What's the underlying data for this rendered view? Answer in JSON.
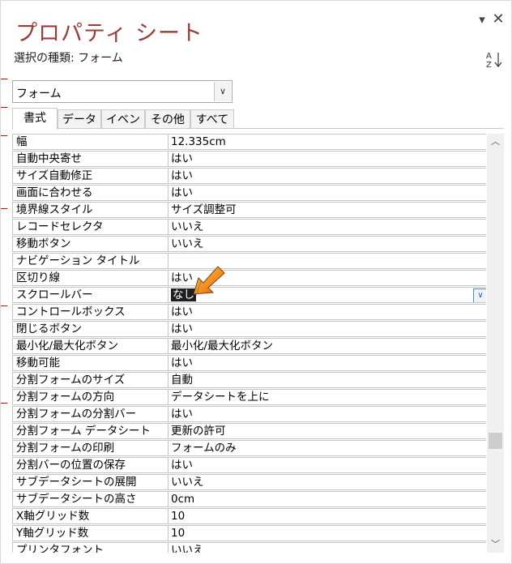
{
  "window": {
    "title": "プロパティ シート",
    "selection_label": "選択の種類: フォーム",
    "dropdown_icon": "chevron-down",
    "close_icon": "close",
    "sort_icon": "sort-az"
  },
  "object_combo": {
    "value": "フォーム"
  },
  "tabs": [
    {
      "label": "書式",
      "active": true
    },
    {
      "label": "データ",
      "active": false
    },
    {
      "label": "イベント",
      "active": false
    },
    {
      "label": "その他",
      "active": false
    },
    {
      "label": "すべて",
      "active": false
    }
  ],
  "properties": [
    {
      "name": "幅",
      "value": "12.335cm"
    },
    {
      "name": "自動中央寄せ",
      "value": "はい"
    },
    {
      "name": "サイズ自動修正",
      "value": "はい"
    },
    {
      "name": "画面に合わせる",
      "value": "はい"
    },
    {
      "name": "境界線スタイル",
      "value": "サイズ調整可"
    },
    {
      "name": "レコードセレクタ",
      "value": "いいえ"
    },
    {
      "name": "移動ボタン",
      "value": "いいえ"
    },
    {
      "name": "ナビゲーション タイトル",
      "value": ""
    },
    {
      "name": "区切り線",
      "value": "はい"
    },
    {
      "name": "スクロールバー",
      "value": "なし",
      "selected": true
    },
    {
      "name": "コントロールボックス",
      "value": "はい"
    },
    {
      "name": "閉じるボタン",
      "value": "はい"
    },
    {
      "name": "最小化/最大化ボタン",
      "value": "最小化/最大化ボタン"
    },
    {
      "name": "移動可能",
      "value": "はい"
    },
    {
      "name": "分割フォームのサイズ",
      "value": "自動"
    },
    {
      "name": "分割フォームの方向",
      "value": "データシートを上に"
    },
    {
      "name": "分割フォームの分割バー",
      "value": "はい"
    },
    {
      "name": "分割フォーム データシート",
      "value": "更新の許可"
    },
    {
      "name": "分割フォームの印刷",
      "value": "フォームのみ"
    },
    {
      "name": "分割バーの位置の保存",
      "value": "はい"
    },
    {
      "name": "サブデータシートの展開",
      "value": "いいえ"
    },
    {
      "name": "サブデータシートの高さ",
      "value": "0cm"
    },
    {
      "name": "X軸グリッド数",
      "value": "10"
    },
    {
      "name": "Y軸グリッド数",
      "value": "10"
    },
    {
      "name": "プリンタフォント",
      "value": "いいえ"
    }
  ],
  "colors": {
    "title": "#9b3b36",
    "pointer": "#f08a1c"
  }
}
